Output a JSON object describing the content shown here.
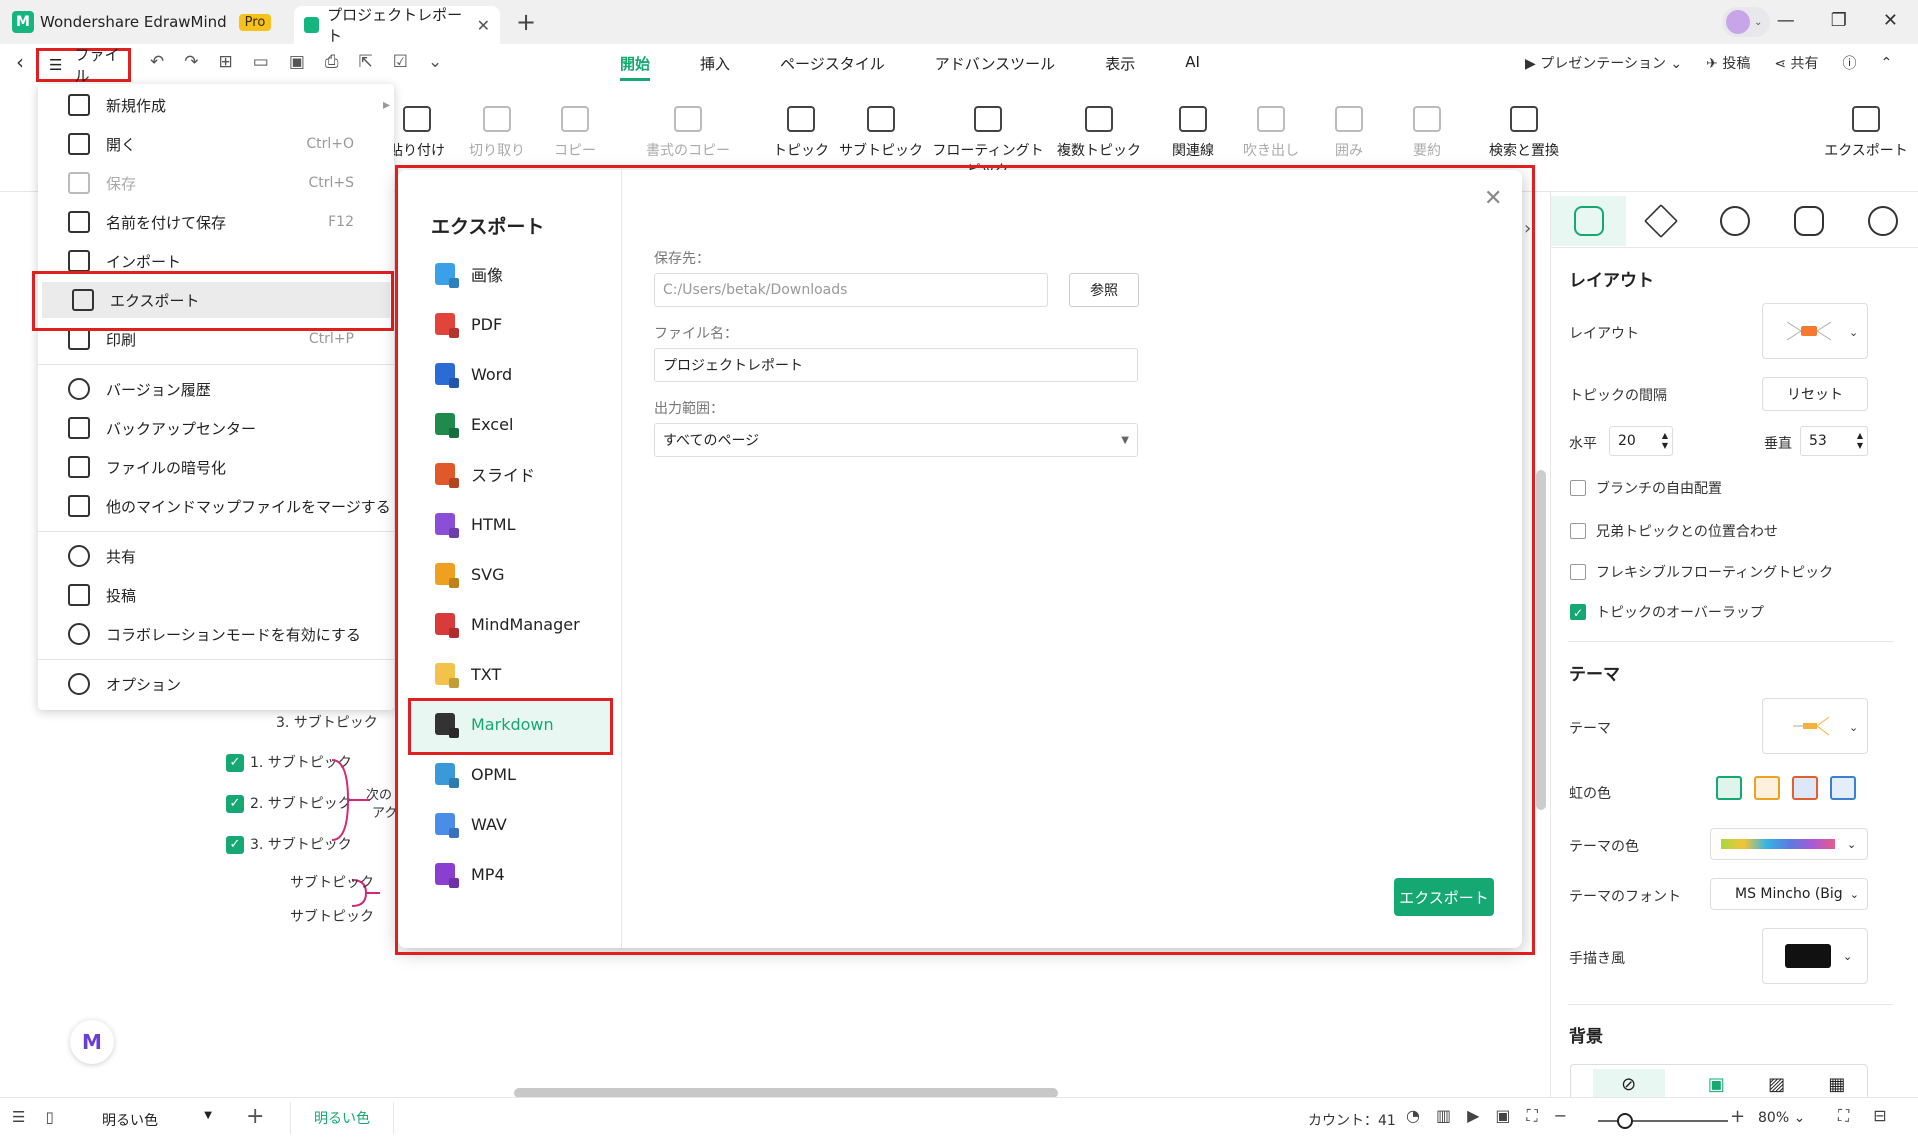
{
  "app": {
    "name": "Wondershare EdrawMind",
    "badge": "Pro",
    "doc_tab": "プロジェクトレポート"
  },
  "menubar": {
    "file_label": "ファイル",
    "tabs": [
      "開始",
      "挿入",
      "ページスタイル",
      "アドバンスツール",
      "表示",
      "AI"
    ],
    "active_tab": "開始",
    "right": {
      "presentation": "プレゼンテーション",
      "post": "投稿",
      "share": "共有"
    }
  },
  "ribbon": {
    "paste": "貼り付け",
    "cut": "切り取り",
    "copy": "コピー",
    "format_copy": "書式のコピー",
    "topic": "トピック",
    "subtopic": "サブトピック",
    "floating_topic": "フローティングトピック",
    "multi_topic": "複数トピック",
    "relation": "関連線",
    "callout": "吹き出し",
    "boundary": "囲み",
    "summary": "要約",
    "find_replace": "検索と置換",
    "export": "エクスポート"
  },
  "file_menu": {
    "items": [
      {
        "label": "新規作成",
        "shortcut": ""
      },
      {
        "label": "開く",
        "shortcut": "Ctrl+O"
      },
      {
        "label": "保存",
        "shortcut": "Ctrl+S"
      },
      {
        "label": "名前を付けて保存",
        "shortcut": "F12"
      },
      {
        "label": "インポート",
        "shortcut": ""
      },
      {
        "label": "エクスポート",
        "shortcut": ""
      },
      {
        "label": "印刷",
        "shortcut": "Ctrl+P"
      },
      {
        "label": "バージョン履歴",
        "shortcut": ""
      },
      {
        "label": "バックアップセンター",
        "shortcut": ""
      },
      {
        "label": "ファイルの暗号化",
        "shortcut": ""
      },
      {
        "label": "他のマインドマップファイルをマージする",
        "shortcut": ""
      },
      {
        "label": "共有",
        "shortcut": ""
      },
      {
        "label": "投稿",
        "shortcut": ""
      },
      {
        "label": "コラボレーションモードを有効にする",
        "shortcut": ""
      },
      {
        "label": "オプション",
        "shortcut": ""
      }
    ]
  },
  "export_dialog": {
    "title": "エクスポート",
    "formats": [
      "画像",
      "PDF",
      "Word",
      "Excel",
      "スライド",
      "HTML",
      "SVG",
      "MindManager",
      "TXT",
      "Markdown",
      "OPML",
      "WAV",
      "MP4"
    ],
    "format_colors": [
      "#3aa0e8",
      "#e0443a",
      "#2b6cd4",
      "#1f8a4c",
      "#e0592a",
      "#8a4fd6",
      "#f0a020",
      "#d93a3a",
      "#f2c24a",
      "#333333",
      "#3a9ad9",
      "#4a8de8",
      "#8a3fd0"
    ],
    "selected": "Markdown",
    "save_label": "保存先：",
    "save_path": "C:/Users/betak/Downloads",
    "browse": "参照",
    "filename_label": "ファイル名：",
    "filename": "プロジェクトレポート",
    "range_label": "出力範囲：",
    "range": "すべてのページ",
    "export_button": "エクスポート"
  },
  "canvas": {
    "sub3a": "3. サブトピック",
    "checked": [
      "1. サブトピック",
      "2. サブトピック",
      "3. サブトピック"
    ],
    "next": "次の",
    "next2": "アク",
    "sub_a": "サブトピック",
    "sub_b": "サブトピック"
  },
  "right_panel": {
    "layout_heading": "レイアウト",
    "layout_label": "レイアウト",
    "topic_spacing": "トピックの間隔",
    "reset": "リセット",
    "horizontal": "水平",
    "horizontal_val": "20",
    "vertical": "垂直",
    "vertical_val": "53",
    "checks": [
      {
        "label": "ブランチの自由配置",
        "on": false
      },
      {
        "label": "兄弟トピックとの位置合わせ",
        "on": false
      },
      {
        "label": "フレキシブルフローティングトピック",
        "on": false
      },
      {
        "label": "トピックのオーバーラップ",
        "on": true
      }
    ],
    "theme_heading": "テーマ",
    "theme": "テーマ",
    "rainbow": "虹の色",
    "theme_color": "テーマの色",
    "theme_font": "テーマのフォント",
    "font_value": "MS Mincho (Big",
    "hand_drawn": "手描き風",
    "background_heading": "背景"
  },
  "status": {
    "theme": "明るい色",
    "page_tab": "明るい色",
    "count": "カウント：41",
    "zoom": "80%"
  }
}
